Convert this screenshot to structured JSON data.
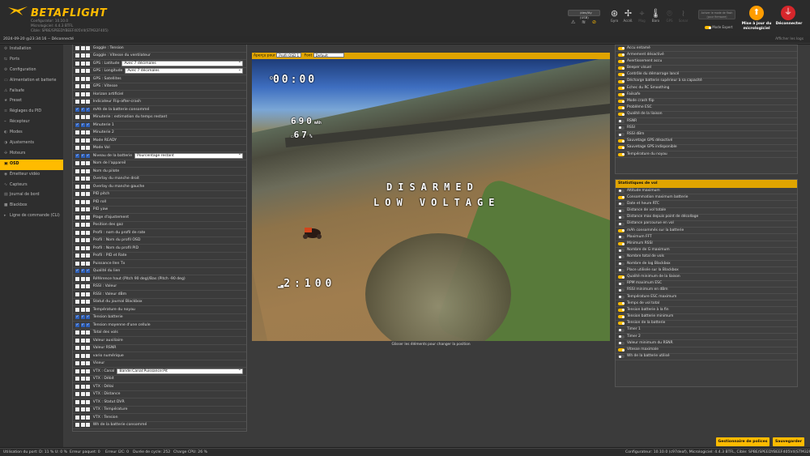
{
  "header": {
    "brand": "BETAFLIGHT",
    "configurator_version": "Configurator: 10.10.0",
    "firmware_version": "Micrologiciel: 4.4.3 BTFL",
    "target_info": "Cible: SPBE/SPEEDYBEEF405V4(STM32F405)",
    "port_label": "/dev/tty (USB)",
    "auto_connect": "Activer le mode de flash (pour firmware)",
    "expert_mode": "Mode Expert",
    "flash_label": "Mise à jour du micrologiciel",
    "disconnect_label": "Déconnecter",
    "sensors": [
      {
        "name": "gyro",
        "label": "Gyro",
        "on": true
      },
      {
        "name": "accel",
        "label": "Accél.",
        "on": true
      },
      {
        "name": "mag",
        "label": "Mag",
        "on": false
      },
      {
        "name": "baro",
        "label": "Baro",
        "on": true
      },
      {
        "name": "gps",
        "label": "GPS",
        "on": false
      },
      {
        "name": "sonar",
        "label": "Sonar",
        "on": false
      }
    ]
  },
  "status": {
    "date_line": "2024-09-20 @23:34:16 -- Déconnecté",
    "show_logs": "Afficher les logs"
  },
  "sidebar": {
    "items": [
      {
        "label": "Installation",
        "icon": "wrench-icon",
        "glyph": "⚙"
      },
      {
        "label": "Ports",
        "icon": "plug-icon",
        "glyph": "⇆"
      },
      {
        "label": "Configuration",
        "icon": "gear-icon",
        "glyph": "⚙"
      },
      {
        "label": "Alimentation et batterie",
        "icon": "battery-icon",
        "glyph": "▭"
      },
      {
        "label": "Failsafe",
        "icon": "warning-icon",
        "glyph": "⚠"
      },
      {
        "label": "Preset",
        "icon": "star-icon",
        "glyph": "★"
      },
      {
        "label": "Réglages du PID",
        "icon": "sliders-icon",
        "glyph": "≡"
      },
      {
        "label": "Récepteur",
        "icon": "antenna-icon",
        "glyph": "⌁"
      },
      {
        "label": "Modes",
        "icon": "toggle-icon",
        "glyph": "◐"
      },
      {
        "label": "Ajustements",
        "icon": "adjust-icon",
        "glyph": "◑"
      },
      {
        "label": "Moteurs",
        "icon": "motor-icon",
        "glyph": "✣"
      },
      {
        "label": "OSD",
        "icon": "screen-icon",
        "glyph": "▣"
      },
      {
        "label": "Émetteur vidéo",
        "icon": "video-icon",
        "glyph": "◉"
      },
      {
        "label": "Capteurs",
        "icon": "sensor-icon",
        "glyph": "∿"
      },
      {
        "label": "Journal de bord",
        "icon": "log-icon",
        "glyph": "▤"
      },
      {
        "label": "Blackbox",
        "icon": "blackbox-icon",
        "glyph": "■"
      },
      {
        "label": "Ligne de commande (CLI)",
        "icon": "terminal-icon",
        "glyph": "▸"
      }
    ]
  },
  "elements": [
    {
      "c": [
        0,
        0,
        0
      ],
      "label": "Goggle : Tension"
    },
    {
      "c": [
        0,
        0,
        0
      ],
      "label": "Goggle : Vitesse du ventilateur"
    },
    {
      "c": [
        0,
        0,
        0
      ],
      "label": "GPS : Latitude",
      "select": "Avec 7 décimales"
    },
    {
      "c": [
        0,
        0,
        0
      ],
      "label": "GPS : Longitude",
      "select": "Avec 7 décimales"
    },
    {
      "c": [
        0,
        0,
        0
      ],
      "label": "GPS : Satellites"
    },
    {
      "c": [
        0,
        0,
        0
      ],
      "label": "GPS : Vitesse"
    },
    {
      "c": [
        0,
        0,
        0
      ],
      "label": "Horizon artificiel"
    },
    {
      "c": [
        0,
        0,
        0
      ],
      "label": "Indicateur Flip-after-crash"
    },
    {
      "c": [
        1,
        1,
        1
      ],
      "label": "mAh de la batterie consommé"
    },
    {
      "c": [
        0,
        0,
        0
      ],
      "label": "Minuterie : estimation du temps restant"
    },
    {
      "c": [
        1,
        1,
        1
      ],
      "label": "Minuterie 1"
    },
    {
      "c": [
        0,
        0,
        0
      ],
      "label": "Minuterie 2"
    },
    {
      "c": [
        0,
        0,
        0
      ],
      "label": "Mode READY"
    },
    {
      "c": [
        0,
        0,
        0
      ],
      "label": "Mode Vol"
    },
    {
      "c": [
        1,
        1,
        1
      ],
      "label": "Niveau de la batterie",
      "select": "Pourcentage restant"
    },
    {
      "c": [
        0,
        0,
        0
      ],
      "label": "Nom de l'appareil"
    },
    {
      "c": [
        0,
        0,
        0
      ],
      "label": "Nom du pilote"
    },
    {
      "c": [
        0,
        0,
        0
      ],
      "label": "Overlay du manche droit"
    },
    {
      "c": [
        0,
        0,
        0
      ],
      "label": "Overlay du manche gauche"
    },
    {
      "c": [
        0,
        0,
        0
      ],
      "label": "PID pitch"
    },
    {
      "c": [
        0,
        0,
        0
      ],
      "label": "PID roll"
    },
    {
      "c": [
        0,
        0,
        0
      ],
      "label": "PID yaw"
    },
    {
      "c": [
        0,
        0,
        0
      ],
      "label": "Plage d'ajustement"
    },
    {
      "c": [
        0,
        0,
        0
      ],
      "label": "Position des gaz"
    },
    {
      "c": [
        0,
        0,
        0
      ],
      "label": "Profil : nom du profil de rate"
    },
    {
      "c": [
        0,
        0,
        0
      ],
      "label": "Profil : Nom du profil OSD"
    },
    {
      "c": [
        0,
        0,
        0
      ],
      "label": "Profil : Nom du profil PID"
    },
    {
      "c": [
        0,
        0,
        0
      ],
      "label": "Profil : PID et Rate"
    },
    {
      "c": [
        0,
        0,
        0
      ],
      "label": "Puissance Ilen Tx"
    },
    {
      "c": [
        1,
        1,
        1
      ],
      "label": "Qualité du lien"
    },
    {
      "c": [
        0,
        0,
        0
      ],
      "label": "Référence haut (Pitch 90 deg)/Bas (Pitch -90 deg)"
    },
    {
      "c": [
        0,
        0,
        0
      ],
      "label": "RSSI : Valeur"
    },
    {
      "c": [
        0,
        0,
        0
      ],
      "label": "RSSI : Valeur dBm"
    },
    {
      "c": [
        0,
        0,
        0
      ],
      "label": "Statut du journal Blackbox"
    },
    {
      "c": [
        0,
        0,
        0
      ],
      "label": "Température du noyau"
    },
    {
      "c": [
        1,
        1,
        1
      ],
      "label": "Tension batterie"
    },
    {
      "c": [
        1,
        1,
        1
      ],
      "label": "Tension moyenne d'une cellule"
    },
    {
      "c": [
        0,
        0,
        0
      ],
      "label": "Total des vols"
    },
    {
      "c": [
        0,
        0,
        0
      ],
      "label": "Valeur auxiliaire"
    },
    {
      "c": [
        0,
        0,
        0
      ],
      "label": "Valeur RSNR"
    },
    {
      "c": [
        0,
        0,
        0
      ],
      "label": "vario numérique"
    },
    {
      "c": [
        0,
        0,
        0
      ],
      "label": "Viseur"
    },
    {
      "c": [
        0,
        0,
        0
      ],
      "label": "VTX : Canal",
      "select": "Bande:Canal:Puissance:Pit"
    },
    {
      "c": [
        0,
        0,
        0
      ],
      "label": "VTX : Débit"
    },
    {
      "c": [
        0,
        0,
        0
      ],
      "label": "VTX : Délai"
    },
    {
      "c": [
        0,
        0,
        0
      ],
      "label": "VTX : Distance"
    },
    {
      "c": [
        0,
        0,
        0
      ],
      "label": "VTX : Statut DVR"
    },
    {
      "c": [
        0,
        0,
        0
      ],
      "label": "VTX : Température"
    },
    {
      "c": [
        0,
        0,
        0
      ],
      "label": "VTX : Tension"
    },
    {
      "c": [
        0,
        0,
        0
      ],
      "label": "Wh de la batterie consommé"
    }
  ],
  "preview": {
    "label": "Aperçu pour",
    "profile": "Profil OSD 1",
    "font_label": "Font",
    "font": "Default",
    "hint": "Glisser les éléments pour changer la position",
    "osd": {
      "timer1": "00:00",
      "mah": "690",
      "mah_unit": "mAh",
      "pct": "67",
      "pct_unit": "%",
      "disarmed": "DISARMED",
      "low_voltage": "LOW VOLTAGE",
      "link": "2:100"
    }
  },
  "warnings": [
    {
      "on": true,
      "label": "Accu entamé"
    },
    {
      "on": true,
      "label": "Armement désactivé"
    },
    {
      "on": true,
      "label": "Avertissement accu"
    },
    {
      "on": true,
      "label": "Beeper visuel"
    },
    {
      "on": true,
      "label": "Contrôle du démarrage lancé"
    },
    {
      "on": true,
      "label": "Décharge batterie supérieur à sa capacité"
    },
    {
      "on": true,
      "label": "Echec du RC Smoothing"
    },
    {
      "on": true,
      "label": "Failsafe"
    },
    {
      "on": true,
      "label": "Mode crash flip"
    },
    {
      "on": true,
      "label": "Problème ESC"
    },
    {
      "on": true,
      "label": "Qualité de la liaison"
    },
    {
      "on": false,
      "label": "RSNR"
    },
    {
      "on": false,
      "label": "RSSI"
    },
    {
      "on": false,
      "label": "RSSI dBm"
    },
    {
      "on": true,
      "label": "Sauvetage GPS désactivé"
    },
    {
      "on": true,
      "label": "Sauvetage GPS indisponible"
    },
    {
      "on": true,
      "label": "Température du noyau"
    }
  ],
  "stats": {
    "title": "Statistiques de vol",
    "items": [
      {
        "on": false,
        "label": "Altitude maximum"
      },
      {
        "on": true,
        "label": "Consommation maximum batterie"
      },
      {
        "on": false,
        "label": "Date et heure RTC"
      },
      {
        "on": false,
        "label": "Distance de vol totale"
      },
      {
        "on": false,
        "label": "Distance max depuis point de décollage"
      },
      {
        "on": false,
        "label": "Distance parcourue en vol"
      },
      {
        "on": true,
        "label": "mAh consommés sur la batterie"
      },
      {
        "on": false,
        "label": "Maximum FFT"
      },
      {
        "on": true,
        "label": "Minimum RSSI"
      },
      {
        "on": false,
        "label": "Nombre de G maximum"
      },
      {
        "on": false,
        "label": "Nombre total de vols"
      },
      {
        "on": false,
        "label": "Nombre de log Blackbox"
      },
      {
        "on": false,
        "label": "Place utilisée sur la Blackbox"
      },
      {
        "on": true,
        "label": "Qualité minimum de la liaison"
      },
      {
        "on": false,
        "label": "RPM maximum ESC"
      },
      {
        "on": false,
        "label": "RSSI minimum en dBm"
      },
      {
        "on": false,
        "label": "Température ESC maximum"
      },
      {
        "on": true,
        "label": "Temps de vol total"
      },
      {
        "on": true,
        "label": "Tension batterie à la fin"
      },
      {
        "on": true,
        "label": "Tension batterie minimum"
      },
      {
        "on": true,
        "label": "Tension de la batterie"
      },
      {
        "on": false,
        "label": "Timer 1"
      },
      {
        "on": false,
        "label": "Timer 2"
      },
      {
        "on": false,
        "label": "Valeur minimum du RSNR"
      },
      {
        "on": true,
        "label": "Vitesse maximale"
      },
      {
        "on": false,
        "label": "Wh de la batterie utilisé"
      }
    ]
  },
  "buttons": {
    "font_manager": "Gestionnaire de polices",
    "save": "Sauvegarder"
  },
  "footer": {
    "port_usage": "Utilisation du port: D: 11 % U: 0 %",
    "packet_error": "Erreur paquet: 0",
    "i2c_error": "Erreur I2C: 0",
    "cycle_time": "Durée de cycle: 252",
    "cpu_load": "Charge CPU: 26 %",
    "versions": "Configurateur: 10.10.0 (c97deaf), Micrologiciel: 4.4.3 BTFL, Cible: SPBE/SPEEDYBEEF405V4(STM32F405)"
  },
  "colors": {
    "accent": "#ffbb00",
    "flash_button": "#ff9d00",
    "disconnect_button": "#d6262b",
    "checkbox_on": "#2d5fb8"
  }
}
